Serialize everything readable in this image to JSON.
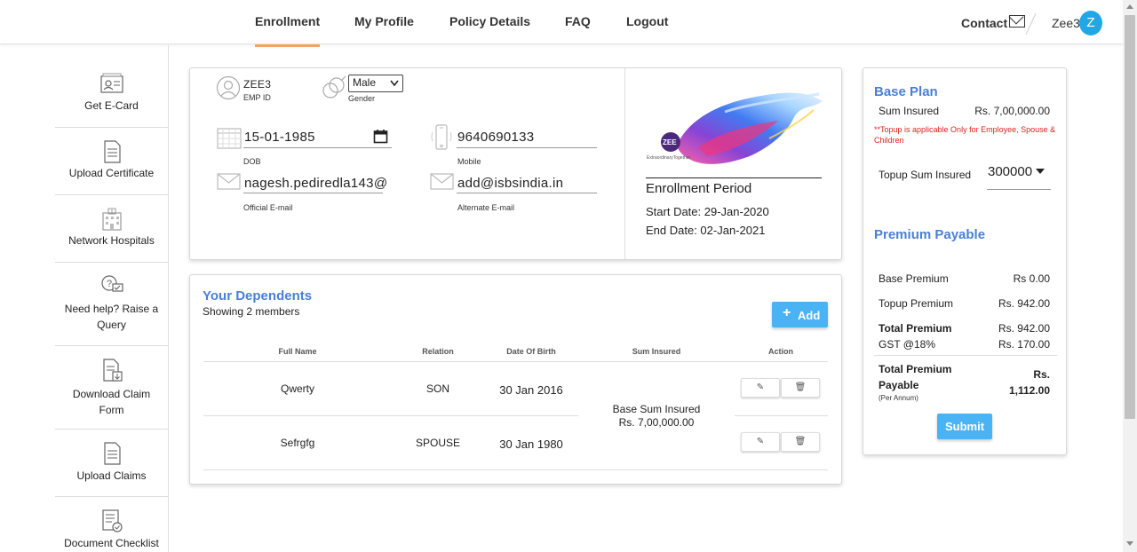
{
  "nav": {
    "tabs": [
      "Enrollment",
      "My Profile",
      "Policy Details",
      "FAQ",
      "Logout"
    ],
    "contact": "Contact",
    "user": "Zee3",
    "avatar": "Z",
    "accent": "#f4a261"
  },
  "sidebar": {
    "items": [
      {
        "label": "Get E-Card",
        "icon": "id-card-icon"
      },
      {
        "label": "Upload Certificate",
        "icon": "certificate-icon"
      },
      {
        "label": "Network Hospitals",
        "icon": "hospital-icon"
      },
      {
        "label": "Need help? Raise a Query",
        "icon": "help-query-icon"
      },
      {
        "label": "Download Claim Form",
        "icon": "download-form-icon"
      },
      {
        "label": "Upload Claims",
        "icon": "upload-claims-icon"
      },
      {
        "label": "Document Checklist",
        "icon": "checklist-icon"
      }
    ]
  },
  "profile": {
    "emp_name": "ZEE3",
    "emp_id_label": "EMP ID",
    "gender": "Male",
    "gender_label": "Gender",
    "dob": "15-01-1985",
    "dob_label": "DOB",
    "mobile": "9640690133",
    "mobile_label": "Mobile",
    "official_email": "nagesh.pediredla143@",
    "official_email_label": "Official E-mail",
    "alt_email": "add@isbsindia.in",
    "alt_email_label": "Alternate E-mail"
  },
  "enrollment": {
    "logo_text": "ZEE",
    "logo_tagline": "ExtraordinaryTogether",
    "title": "Enrollment Period",
    "start": "Start Date: 29-Jan-2020",
    "end": "End Date: 02-Jan-2021"
  },
  "dependents": {
    "title": "Your Dependents",
    "subtitle": "Showing 2 members",
    "add_label": "Add",
    "columns": [
      "Full Name",
      "Relation",
      "Date Of Birth",
      "Sum Insured",
      "Action"
    ],
    "rows": [
      {
        "name": "Qwerty",
        "relation": "SON",
        "dob": "30 Jan 2016"
      },
      {
        "name": "Sefrgfg",
        "relation": "SPOUSE",
        "dob": "30 Jan 1980"
      }
    ],
    "sum_insured_line1": "Base Sum Insured",
    "sum_insured_line2": "Rs. 7,00,000.00"
  },
  "plan": {
    "base_title": "Base Plan",
    "sum_insured_label": "Sum Insured",
    "sum_insured_value": "Rs. 7,00,000.00",
    "topup_note": "**Topup is applicable Only for Employee, Spouse & Children",
    "topup_label": "Topup Sum Insured",
    "topup_value": "300000",
    "premium_title": "Premium Payable",
    "base_premium_label": "Base Premium",
    "base_premium_value": "Rs 0.00",
    "topup_premium_label": "Topup Premium",
    "topup_premium_value": "Rs. 942.00",
    "total_premium_label": "Total Premium",
    "total_premium_value": "Rs. 942.00",
    "gst_label": "GST @18%",
    "gst_value": "Rs. 170.00",
    "payable_label_1": "Total Premium",
    "payable_label_2": "Payable",
    "payable_sub": "(Per Annum)",
    "payable_value_1": "Rs.",
    "payable_value_2": "1,112.00",
    "submit_label": "Submit",
    "note_color": "#e02020",
    "heading_color": "#4a7fd6",
    "button_color": "#4ab3f4"
  }
}
